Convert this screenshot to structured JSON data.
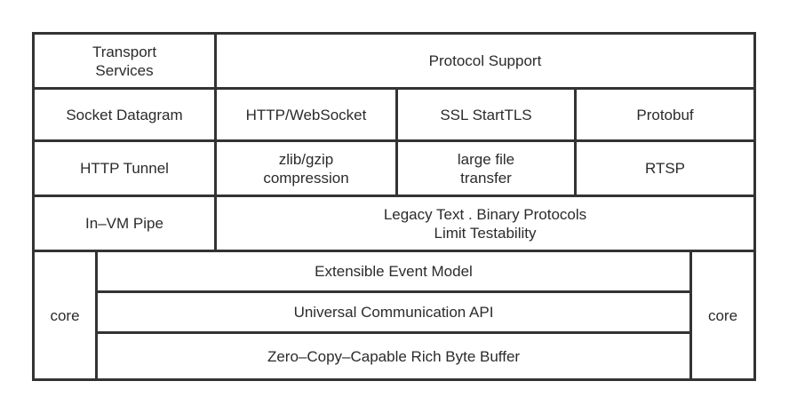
{
  "diagram": {
    "transport_services": "Transport\nServices",
    "protocol_support": "Protocol Support",
    "socket_datagram": "Socket Datagram",
    "http_websocket": "HTTP/WebSocket",
    "ssl_starttls": "SSL StartTLS",
    "protobuf": "Protobuf",
    "http_tunnel": "HTTP Tunnel",
    "zlib_gzip": "zlib/gzip\ncompression",
    "large_file": "large file\ntransfer",
    "rtsp": "RTSP",
    "in_vm_pipe": "In–VM Pipe",
    "legacy_text": "Legacy Text . Binary Protocols\nLimit Testability",
    "core_left": "core",
    "core_right": "core",
    "event_model": "Extensible Event Model",
    "comm_api": "Universal Communication API",
    "byte_buffer": "Zero–Copy–Capable Rich Byte Buffer"
  }
}
